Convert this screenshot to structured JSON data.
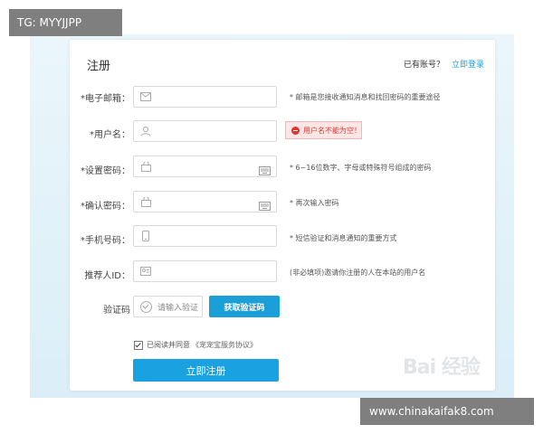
{
  "badges": {
    "telegram": "TG: MYYJJPP",
    "site": "www.chinakaifak8.com"
  },
  "watermark": "Bai 经验",
  "form": {
    "title": "注册",
    "login_prompt": "已有账号？",
    "login_link": "立即登录",
    "rows": [
      {
        "label": "*电子邮箱：",
        "hint": "* 邮箱是您接收通知消息和找回密码的重要途径",
        "icon": "email-icon"
      },
      {
        "label": "*用户名：",
        "hint": "",
        "icon": "user-icon"
      },
      {
        "label": "*设置密码：",
        "hint": "* 6~16位数字、字母或特殊符号组成的密码",
        "icon": "lock-icon"
      },
      {
        "label": "*确认密码：",
        "hint": "* 再次输入密码",
        "icon": "lock-icon"
      },
      {
        "label": "*手机号码：",
        "hint": "* 短信验证和消息通知的重要方式",
        "icon": "phone-icon"
      },
      {
        "label": "推荐人ID：",
        "hint": "(非必填项)邀请你注册的人在本站的用户名",
        "icon": "id-card-icon"
      }
    ],
    "error_message": "用户名不能为空！",
    "code_label": "验证码",
    "code_placeholder": "请输入验证",
    "get_code_button": "获取验证码",
    "agree_text": "已阅读并同意",
    "agreement_link": "《宠宠宝服务协议》",
    "submit_button": "立即注册"
  },
  "colors": {
    "accent": "#1aa1e2",
    "error": "#e0352f",
    "background": "#dbeef8"
  }
}
